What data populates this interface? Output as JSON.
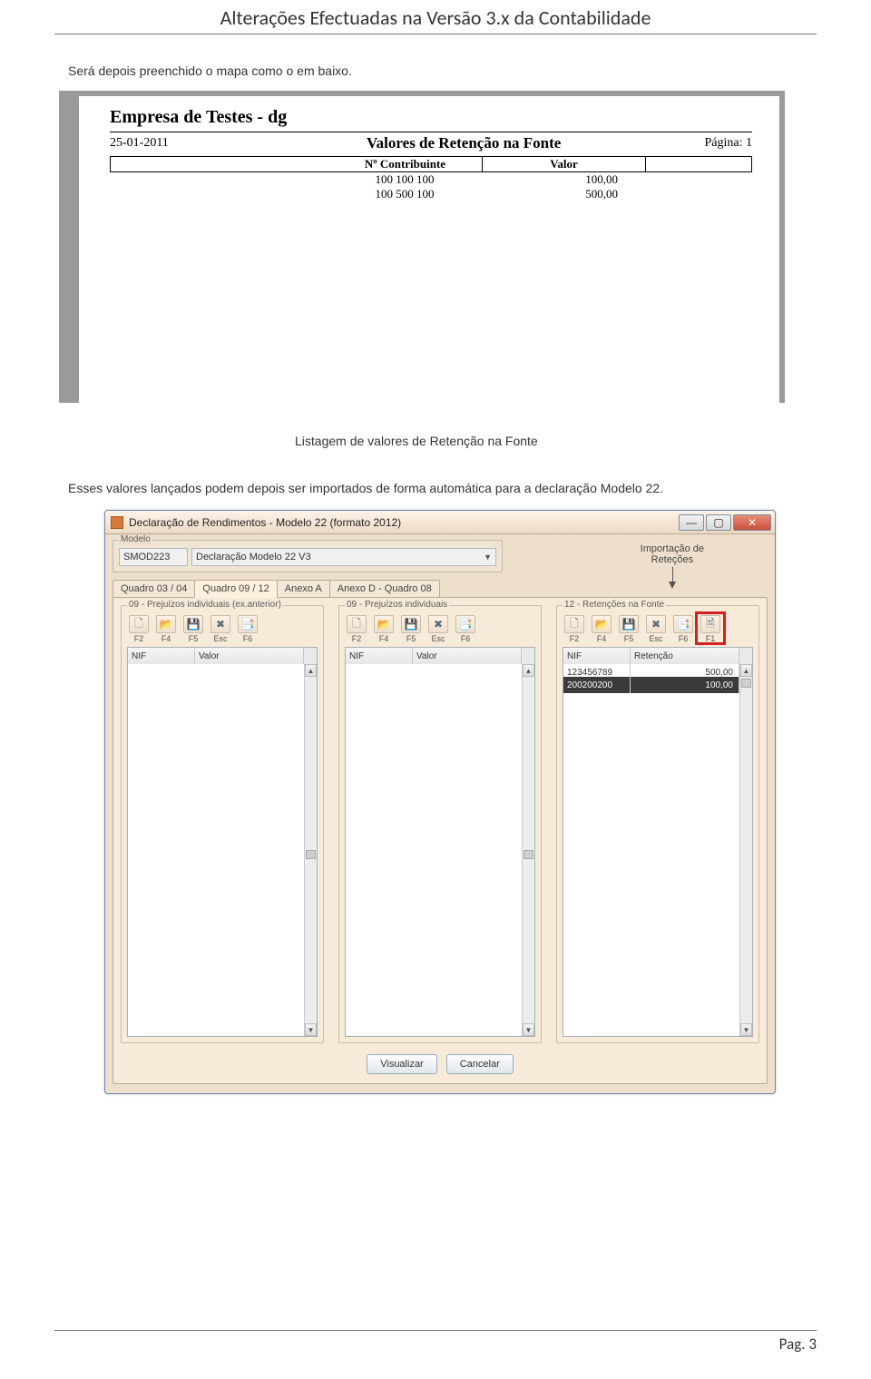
{
  "page_header": "Alterações Efectuadas na Versão 3.x da Contabilidade",
  "para1": "Será depois preenchido o mapa como o em baixo.",
  "caption1": "Listagem de valores de Retenção na Fonte",
  "para2": "Esses valores lançados podem depois ser importados de forma automática para a declaração Modelo 22.",
  "page_footer": "Pag. 3",
  "report": {
    "company": "Empresa de Testes - dg",
    "date": "25-01-2011",
    "title": "Valores de Retenção na Fonte",
    "page_label": "Página:  1",
    "col_contrib": "Nº Contribuinte",
    "col_valor": "Valor",
    "rows": [
      {
        "nif": "100 100 100",
        "valor": "100,00"
      },
      {
        "nif": "100 500 100",
        "valor": "500,00"
      }
    ]
  },
  "appwin": {
    "title": "Declaração de Rendimentos - Modelo 22 (formato 2012)",
    "modelo_group": "Modelo",
    "modelo_code": "SMOD223",
    "modelo_desc": "Declaração Modelo 22 V3",
    "import_label_l1": "Importação de",
    "import_label_l2": "Reteções",
    "tabs": [
      "Quadro 03 / 04",
      "Quadro 09 / 12",
      "Anexo A",
      "Anexo D - Quadro 08"
    ],
    "active_tab_index": 1,
    "panels": [
      {
        "title": "09 - Prejuízos individuais (ex.anterior)",
        "toolbar": [
          "F2",
          "F4",
          "F5",
          "Esc",
          "F6"
        ],
        "cols": [
          "NIF",
          "Valor"
        ]
      },
      {
        "title": "09 - Prejuízos individuais",
        "toolbar": [
          "F2",
          "F4",
          "F5",
          "Esc",
          "F6"
        ],
        "cols": [
          "NIF",
          "Valor"
        ]
      },
      {
        "title": "12 - Retenções na Fonte",
        "toolbar": [
          "F2",
          "F4",
          "F5",
          "Esc",
          "F6",
          "F1"
        ],
        "cols": [
          "NIF",
          "Retenção"
        ],
        "rows": [
          {
            "nif": "123456789",
            "val": "500,00",
            "sel": false
          },
          {
            "nif": "200200200",
            "val": "100,00",
            "sel": true
          }
        ]
      }
    ],
    "btn_view": "Visualizar",
    "btn_cancel": "Cancelar",
    "icons": {
      "new": "🗋",
      "open": "📂",
      "save": "💾",
      "del": "✖",
      "misc": "📑",
      "imp": "🗎"
    }
  }
}
